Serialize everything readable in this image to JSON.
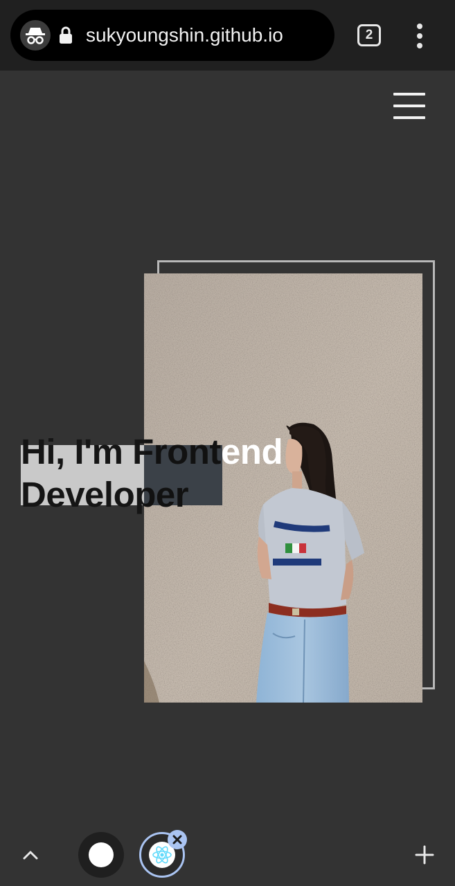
{
  "browser": {
    "url": "sukyoungshin.github.io",
    "tab_count": "2",
    "icons": [
      "incognito-icon",
      "lock-icon",
      "tab-switcher-icon",
      "more-vert-icon"
    ]
  },
  "site": {
    "hero": {
      "title_line1": "Hi, I'm Frontend",
      "title_line2": "Developer"
    }
  },
  "bottom_bar": {
    "icons": [
      "chevron-up-icon",
      "tab-thumbnail",
      "react-tab-thumbnail",
      "close-icon",
      "plus-icon"
    ]
  },
  "colors": {
    "page_bg": "#333333",
    "browser_bar": "#202020",
    "accent_tab": "#aac4f2",
    "react_blue": "#61dafb"
  }
}
